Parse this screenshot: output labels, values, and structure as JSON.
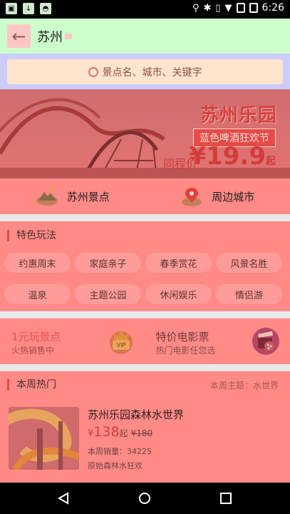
{
  "status_bar": {
    "time": "6:26"
  },
  "header": {
    "city": "苏州"
  },
  "search": {
    "placeholder": "景点名、城市、关键字"
  },
  "banner": {
    "title": "苏州乐园",
    "subtitle": "蓝色啤酒狂欢节",
    "price_label": "同程价",
    "price": "¥19.9",
    "price_suffix": "起"
  },
  "quick_links": [
    {
      "label": "苏州景点",
      "icon": "mountain-icon"
    },
    {
      "label": "周边城市",
      "icon": "location-pin-icon"
    }
  ],
  "features": {
    "title": "特色玩法",
    "tags": [
      "约惠周末",
      "家庭亲子",
      "春季赏花",
      "风景名胜",
      "温泉",
      "主题公园",
      "休闲娱乐",
      "情侣游"
    ]
  },
  "promos": [
    {
      "title": "1元玩景点",
      "subtitle": "火热销售中",
      "icon": "vip-crown-icon"
    },
    {
      "title": "特价电影票",
      "subtitle": "热门电影任您选",
      "icon": "film-clapper-icon"
    }
  ],
  "hot": {
    "title": "本周热门",
    "theme": "本周主题：水世界",
    "item": {
      "name": "苏州乐园森林水世界",
      "currency": "¥",
      "price": "138",
      "price_suffix": "起",
      "original_price": "¥180",
      "sales": "本周销量：34225",
      "description": "原始森林水狂欢"
    }
  },
  "colors": {
    "accent": "#e64b46",
    "appbar_bg": "#ccffcc",
    "search_bg": "#ccccff",
    "content_bg": "#ff8a86"
  }
}
